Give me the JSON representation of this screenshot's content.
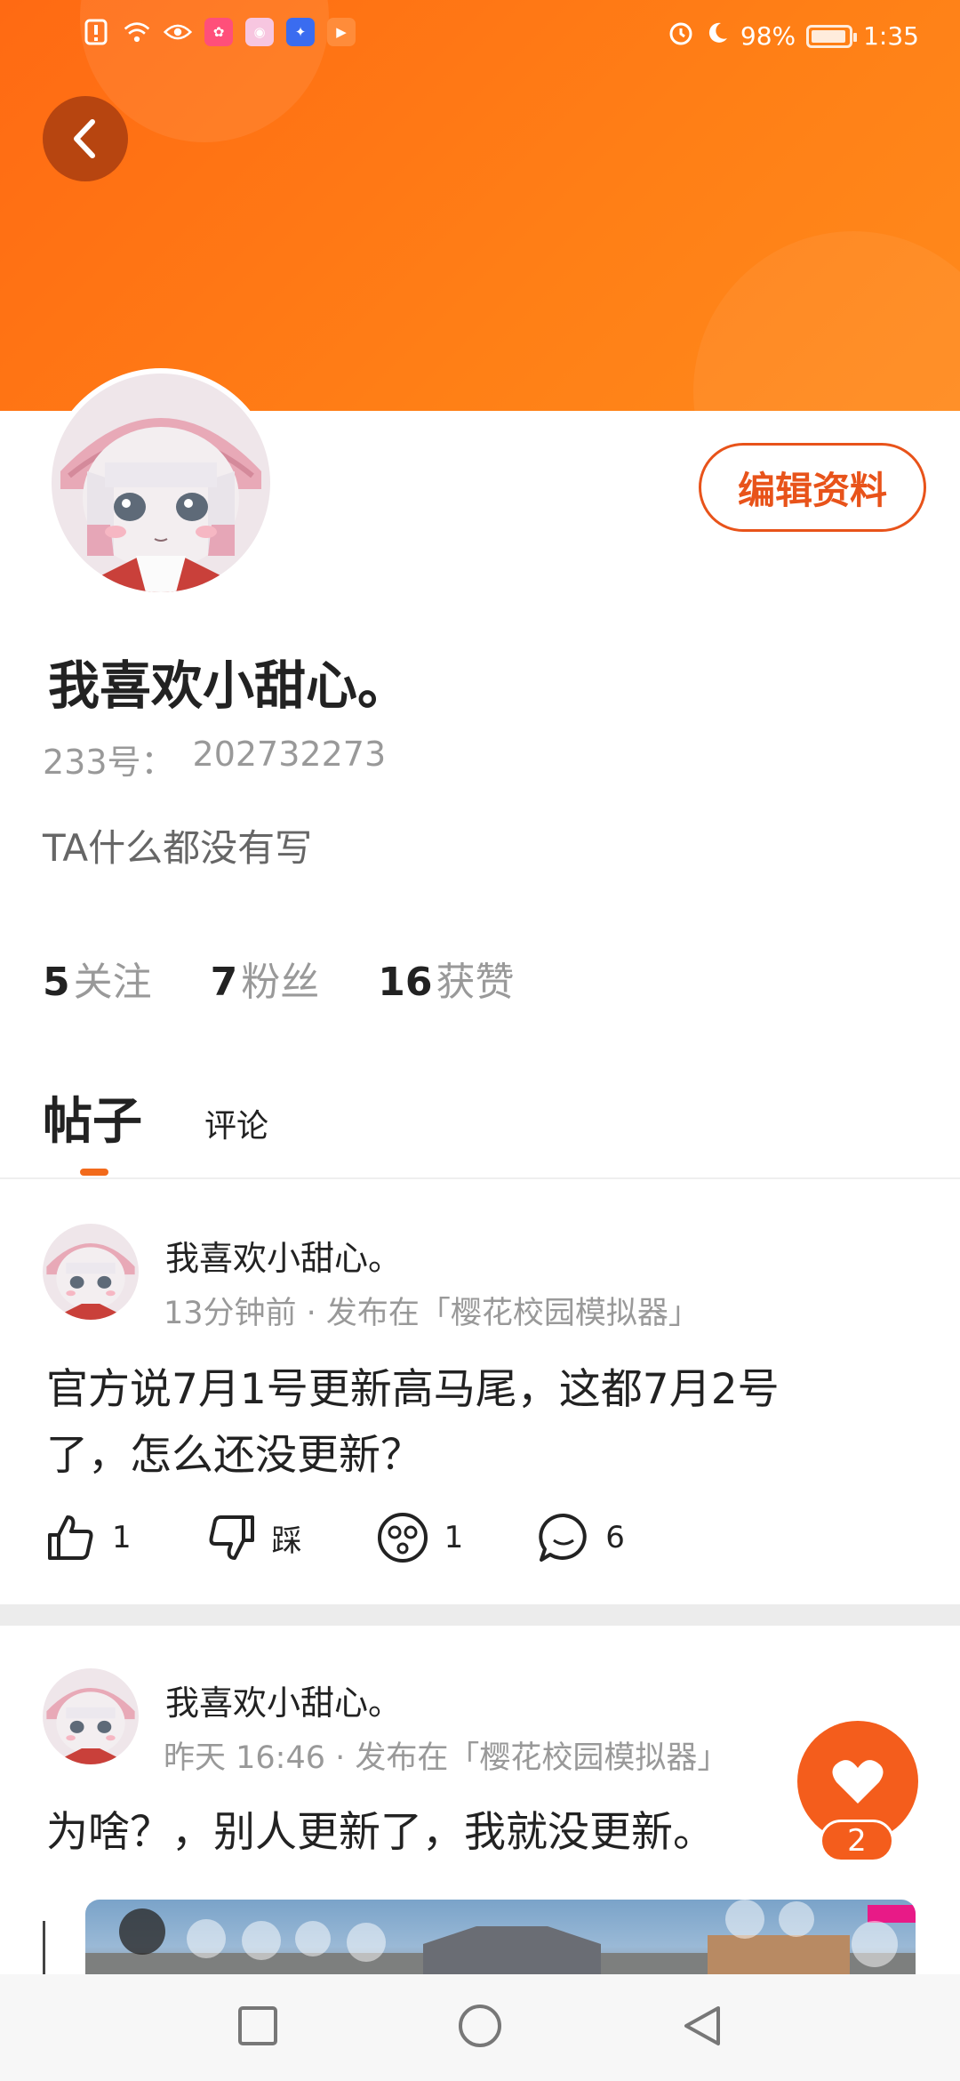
{
  "status_bar": {
    "battery": "98%",
    "time": "1:35"
  },
  "profile": {
    "edit_label": "编辑资料",
    "username": "我喜欢小甜心。",
    "id_label": "233号：",
    "id_value": "202732273",
    "bio": "TA什么都没有写",
    "stats": [
      {
        "num": "5",
        "label": "关注"
      },
      {
        "num": "7",
        "label": "粉丝"
      },
      {
        "num": "16",
        "label": "获赞"
      }
    ]
  },
  "tabs": [
    "帖子",
    "评论"
  ],
  "posts": [
    {
      "author": "我喜欢小甜心。",
      "meta": "13分钟前 · 发布在「樱花校园模拟器」",
      "line1": "官方说7月1号更新高马尾，这都7月2号",
      "line2": "了，怎么还没更新？",
      "likes": "1",
      "dislike_label": "踩",
      "emoji_count": "1",
      "comments": "6"
    },
    {
      "author": "我喜欢小甜心。",
      "meta": "昨天 16:46 · 发布在「樱花校园模拟器」",
      "line1": "为啥？，别人更新了，我就没更新。"
    }
  ],
  "fab": {
    "count": "2"
  },
  "colors": {
    "accent": "#f45d1c",
    "header": "#ff7416"
  }
}
